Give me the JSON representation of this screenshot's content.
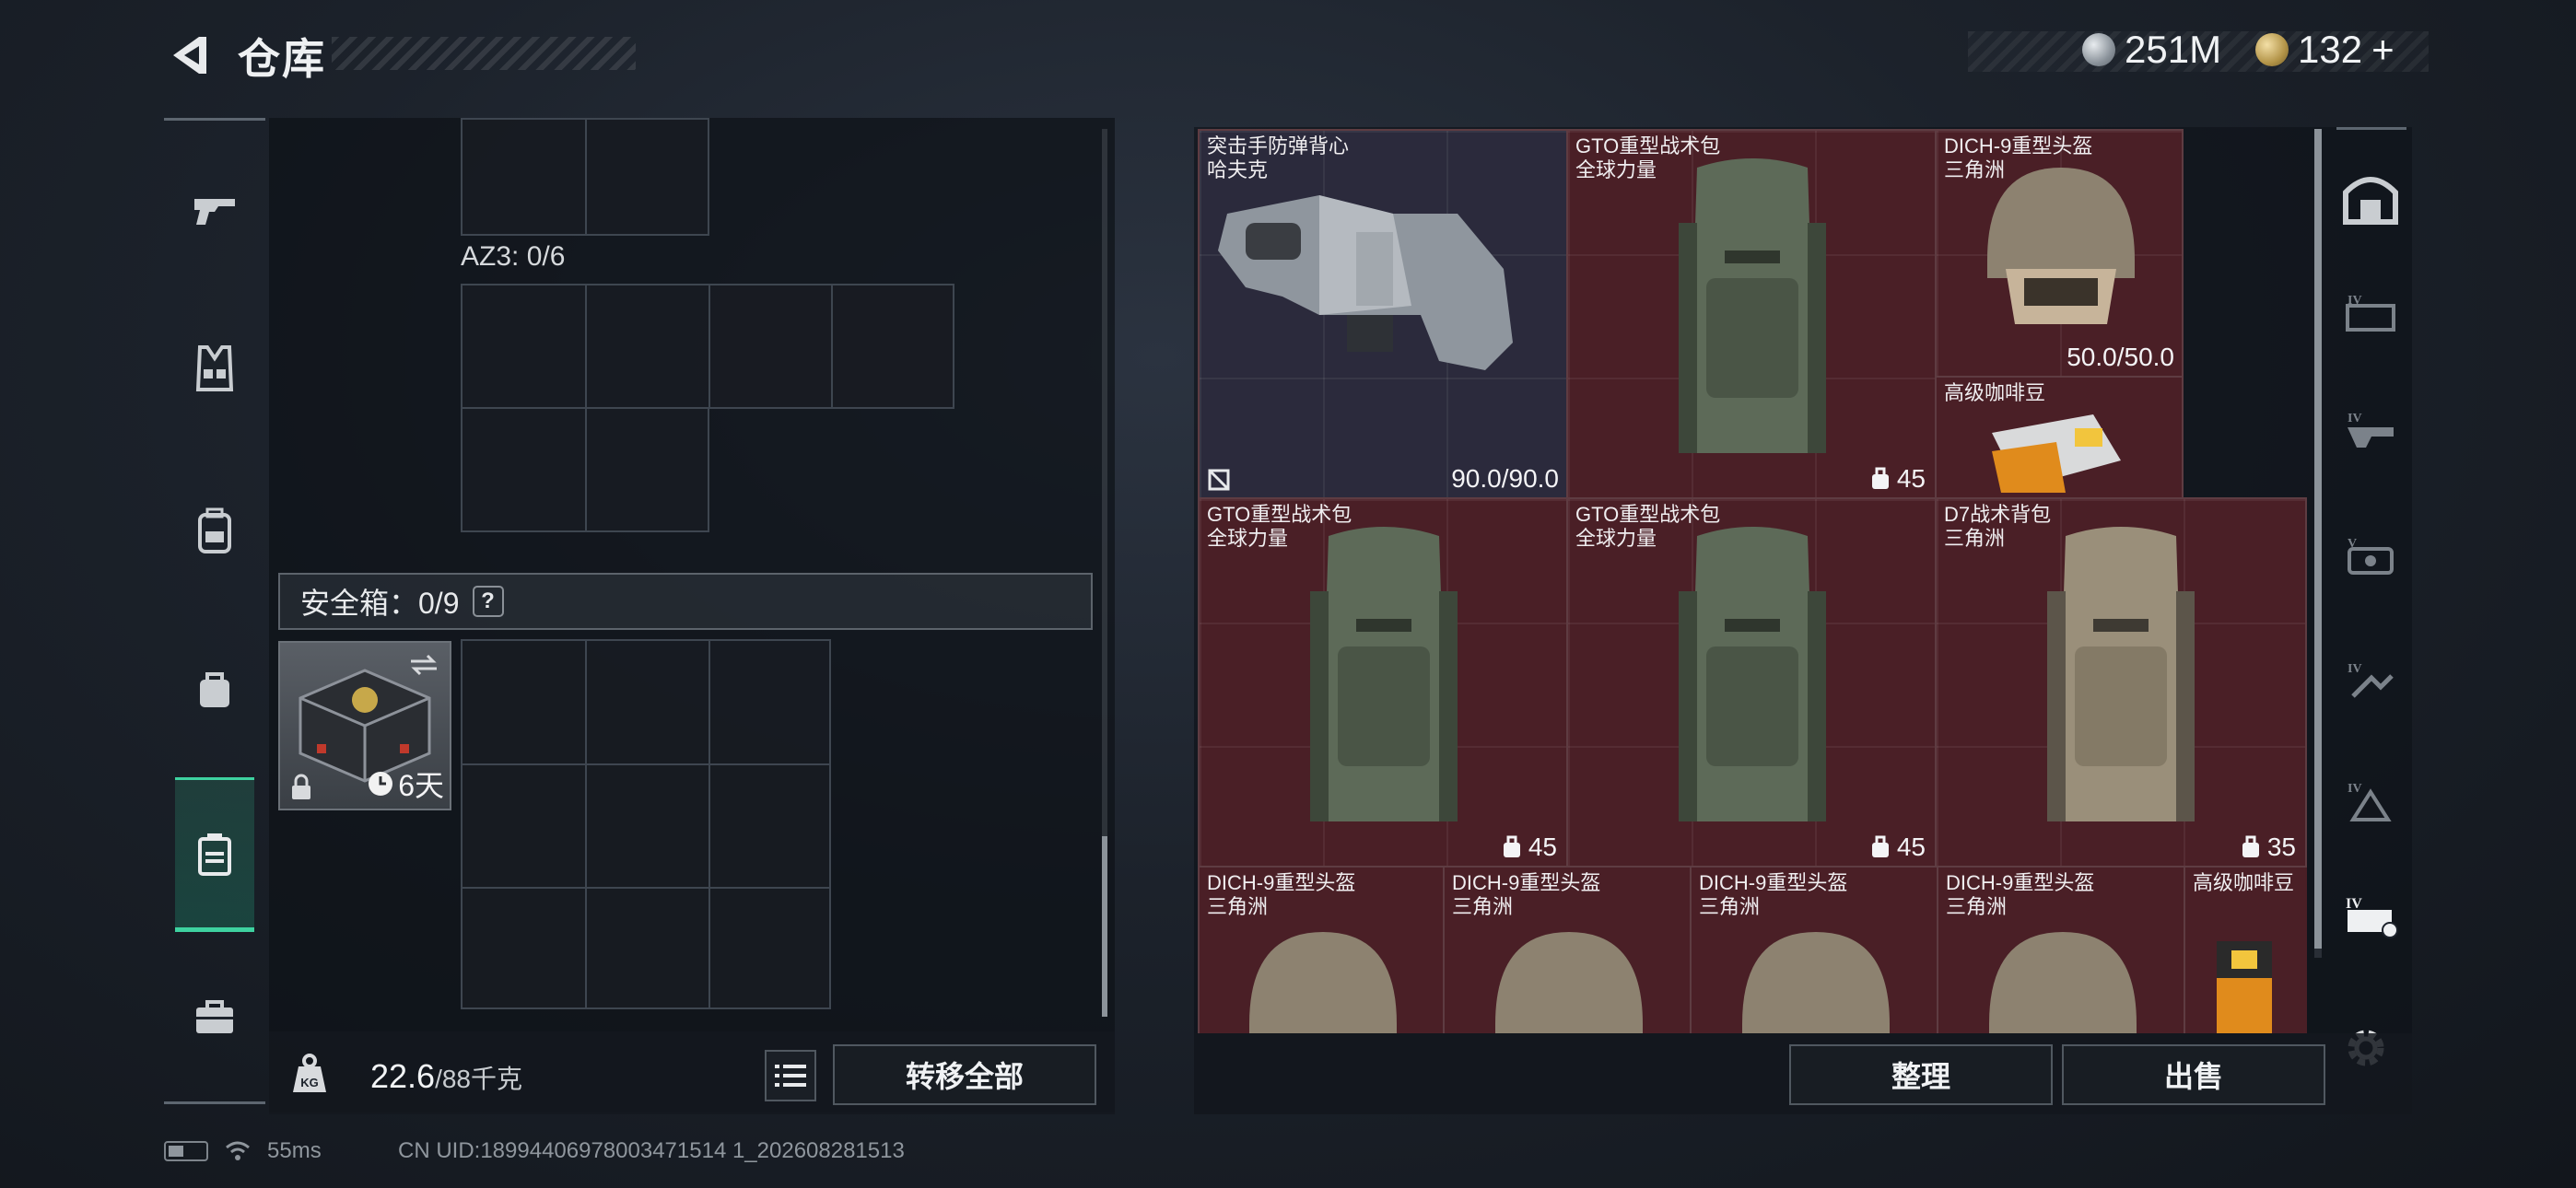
{
  "header": {
    "title": "仓库"
  },
  "currency": {
    "silver": "251M",
    "gold": "132",
    "gold_plus": "+"
  },
  "left": {
    "az3_label": "AZ3: 0/6",
    "safe_box_label": "安全箱：0/9",
    "safe_box_help": "?",
    "safe_item_days": "6天",
    "weight_current": "22.6",
    "weight_max": "/88千克",
    "transfer_all": "转移全部"
  },
  "right": {
    "items": [
      {
        "name": "突击手防弹背心",
        "sub": "哈夫克",
        "durability": "90.0/90.0",
        "kind": "vest"
      },
      {
        "name": "GTO重型战术包",
        "sub": "全球力量",
        "capacity": "45",
        "kind": "backpack"
      },
      {
        "name": "DICH-9重型头盔",
        "sub": "三角洲",
        "durability": "50.0/50.0",
        "kind": "helmet"
      },
      {
        "name": "高级咖啡豆",
        "sub": "",
        "kind": "coffee"
      },
      {
        "name": "GTO重型战术包",
        "sub": "全球力量",
        "capacity": "45",
        "kind": "backpack"
      },
      {
        "name": "GTO重型战术包",
        "sub": "全球力量",
        "capacity": "45",
        "kind": "backpack"
      },
      {
        "name": "D7战术背包",
        "sub": "三角洲",
        "capacity": "35",
        "kind": "backpack"
      },
      {
        "name": "DICH-9重型头盔",
        "sub": "三角洲",
        "kind": "helmet"
      },
      {
        "name": "DICH-9重型头盔",
        "sub": "三角洲",
        "kind": "helmet"
      },
      {
        "name": "DICH-9重型头盔",
        "sub": "三角洲",
        "kind": "helmet"
      },
      {
        "name": "DICH-9重型头盔",
        "sub": "三角洲",
        "kind": "helmet"
      },
      {
        "name": "高级咖啡豆",
        "sub": "",
        "kind": "coffee"
      }
    ],
    "sort_button": "整理",
    "sell_button": "出售"
  },
  "status": {
    "ping": "55ms",
    "uid": "CN UID:18994406978003471514 1_202608281513"
  },
  "colors": {
    "accent": "#3ed2a0",
    "item_red": "#4a1f26",
    "item_dark": "#2b2a3c"
  }
}
